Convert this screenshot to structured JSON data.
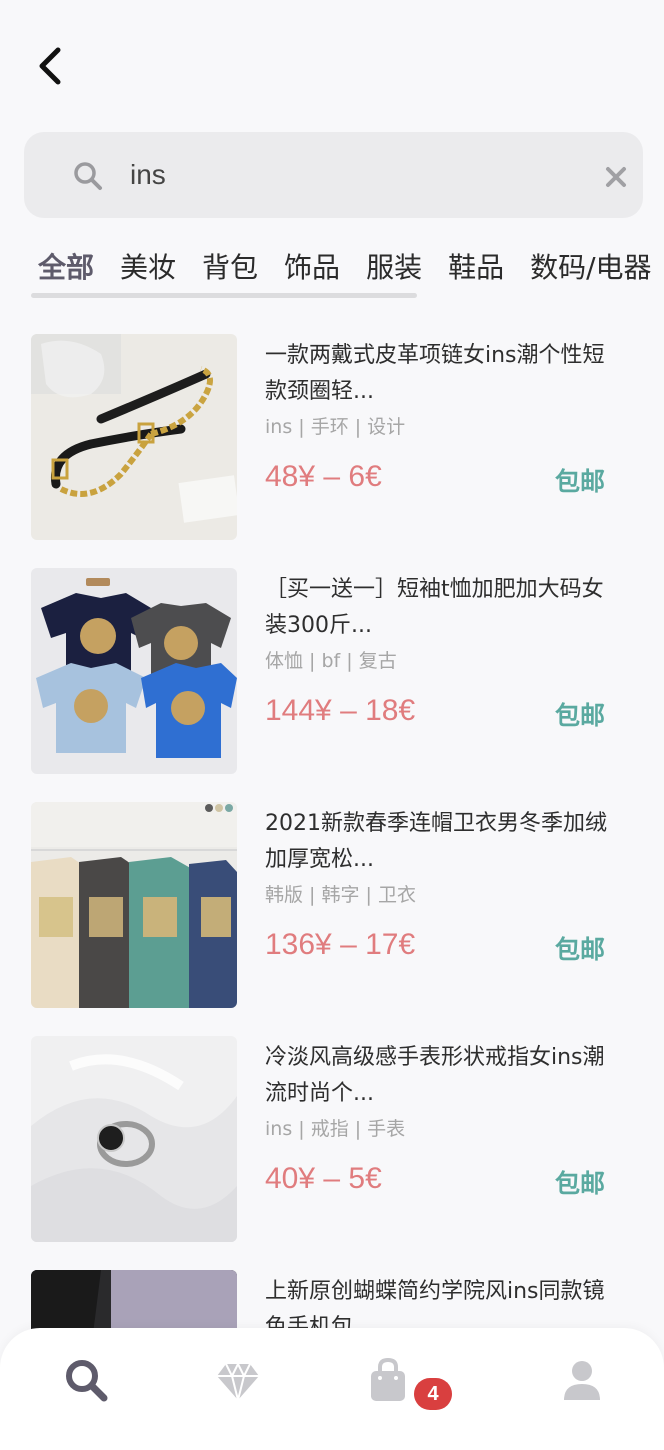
{
  "search": {
    "value": "ins",
    "placeholder": ""
  },
  "tabs": [
    {
      "label": "全部",
      "active": true
    },
    {
      "label": "美妆",
      "active": false
    },
    {
      "label": "背包",
      "active": false
    },
    {
      "label": "饰品",
      "active": false
    },
    {
      "label": "服装",
      "active": false
    },
    {
      "label": "鞋品",
      "active": false
    },
    {
      "label": "数码/电器",
      "active": false
    }
  ],
  "products": [
    {
      "title": "一款两戴式皮革项链女ins潮个性短款颈圈轻...",
      "tags": "ins | 手环 | 设计",
      "price": "48¥ – 6€",
      "shipping": "包邮"
    },
    {
      "title": "［买一送一］短袖t恤加肥加大码女装300斤...",
      "tags": "体恤 | bf | 复古",
      "price": "144¥ – 18€",
      "shipping": "包邮"
    },
    {
      "title": "2021新款春季连帽卫衣男冬季加绒加厚宽松...",
      "tags": "韩版 | 韩字 | 卫衣",
      "price": "136¥ – 17€",
      "shipping": "包邮"
    },
    {
      "title": "冷淡风高级感手表形状戒指女ins潮流时尚个...",
      "tags": "ins | 戒指 | 手表",
      "price": "40¥ – 5€",
      "shipping": "包邮"
    },
    {
      "title": "上新原创蝴蝶简约学院风ins同款镜色手机包",
      "tags": "",
      "price": "",
      "shipping": ""
    }
  ],
  "nav": {
    "cart_badge": "4",
    "items": [
      {
        "icon": "search-icon",
        "active": true
      },
      {
        "icon": "diamond-icon",
        "active": false
      },
      {
        "icon": "shopping-bag-icon",
        "active": false
      },
      {
        "icon": "user-icon",
        "active": false
      }
    ]
  },
  "colors": {
    "price": "#e07c7e",
    "shipping": "#5aa9a0",
    "active_tab": "#5e5b6b",
    "badge": "#d93f3f",
    "nav_active": "#5e5b6b",
    "nav_inactive": "#c8c8cc"
  }
}
